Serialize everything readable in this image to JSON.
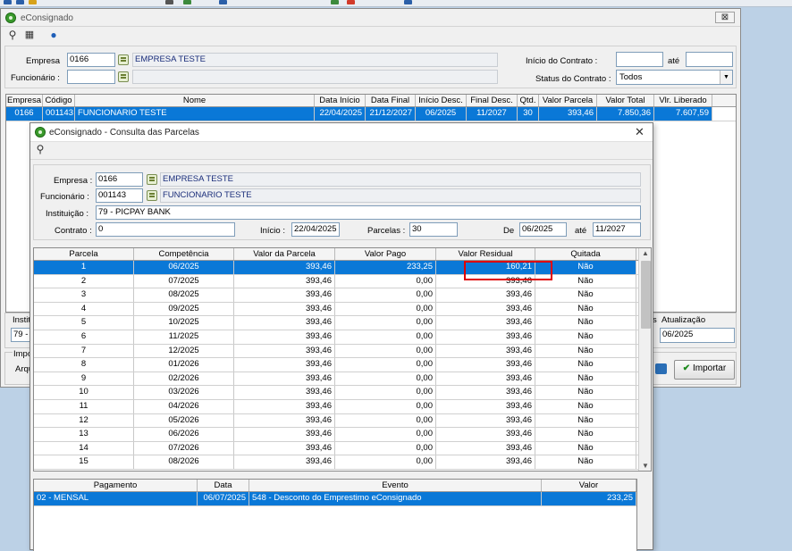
{
  "main": {
    "title": "eConsignado",
    "close_label": "⊠",
    "empresa": {
      "label": "Empresa",
      "code": "0166",
      "name": "EMPRESA TESTE"
    },
    "funcionario": {
      "label": "Funcionário :",
      "code": "",
      "name": ""
    },
    "inicio_contrato": {
      "label": "Início do Contrato :",
      "value": "",
      "ate_label": "até",
      "ate_value": ""
    },
    "status": {
      "label": "Status do Contrato :",
      "value": "Todos"
    },
    "grid": {
      "headers": [
        "Empresa",
        "Código",
        "Nome",
        "Data Início",
        "Data Final",
        "Início Desc.",
        "Final Desc.",
        "Qtd.",
        "Valor Parcela",
        "Valor Total",
        "Vlr. Liberado"
      ],
      "rows": [
        [
          "0166",
          "001143",
          "FUNCIONARIO TESTE",
          "22/04/2025",
          "21/12/2027",
          "06/2025",
          "11/2027",
          "30",
          "393,46",
          "7.850,36",
          "7.607,59"
        ]
      ]
    },
    "bottom": {
      "instituicao_label": "Instit",
      "instituicao_value": "79 - I",
      "importacao_label": "Impo",
      "arquivo_label": "Arqu",
      "atualizacao_label": "Atualização",
      "atualizacao_value": "06/2025",
      "atualizacao_prefix": "s",
      "importar_label": "Importar"
    }
  },
  "dialog": {
    "title": "eConsignado - Consulta das Parcelas",
    "close_label": "✕",
    "empresa": {
      "label": "Empresa :",
      "code": "0166",
      "name": "EMPRESA TESTE"
    },
    "funcionario": {
      "label": "Funcionário :",
      "code": "001143",
      "name": "FUNCIONARIO TESTE"
    },
    "instituicao": {
      "label": "Instituição :",
      "value": "79 - PICPAY BANK"
    },
    "contrato": {
      "label": "Contrato :",
      "value": "0"
    },
    "inicio": {
      "label": "Início :",
      "value": "22/04/2025"
    },
    "parcelas": {
      "label": "Parcelas :",
      "value": "30"
    },
    "de": {
      "label": "De",
      "value": "06/2025"
    },
    "ate": {
      "label": "até",
      "value": "11/2027"
    },
    "parcelas_grid": {
      "headers": [
        "Parcela",
        "Competência",
        "Valor da Parcela",
        "Valor Pago",
        "Valor Residual",
        "Quitada"
      ],
      "rows": [
        [
          "1",
          "06/2025",
          "393,46",
          "233,25",
          "160,21",
          "Não"
        ],
        [
          "2",
          "07/2025",
          "393,46",
          "0,00",
          "393,46",
          "Não"
        ],
        [
          "3",
          "08/2025",
          "393,46",
          "0,00",
          "393,46",
          "Não"
        ],
        [
          "4",
          "09/2025",
          "393,46",
          "0,00",
          "393,46",
          "Não"
        ],
        [
          "5",
          "10/2025",
          "393,46",
          "0,00",
          "393,46",
          "Não"
        ],
        [
          "6",
          "11/2025",
          "393,46",
          "0,00",
          "393,46",
          "Não"
        ],
        [
          "7",
          "12/2025",
          "393,46",
          "0,00",
          "393,46",
          "Não"
        ],
        [
          "8",
          "01/2026",
          "393,46",
          "0,00",
          "393,46",
          "Não"
        ],
        [
          "9",
          "02/2026",
          "393,46",
          "0,00",
          "393,46",
          "Não"
        ],
        [
          "10",
          "03/2026",
          "393,46",
          "0,00",
          "393,46",
          "Não"
        ],
        [
          "11",
          "04/2026",
          "393,46",
          "0,00",
          "393,46",
          "Não"
        ],
        [
          "12",
          "05/2026",
          "393,46",
          "0,00",
          "393,46",
          "Não"
        ],
        [
          "13",
          "06/2026",
          "393,46",
          "0,00",
          "393,46",
          "Não"
        ],
        [
          "14",
          "07/2026",
          "393,46",
          "0,00",
          "393,46",
          "Não"
        ],
        [
          "15",
          "08/2026",
          "393,46",
          "0,00",
          "393,46",
          "Não"
        ]
      ]
    },
    "pagamentos_grid": {
      "headers": [
        "Pagamento",
        "Data",
        "Evento",
        "Valor"
      ],
      "rows": [
        [
          "02 - MENSAL",
          "06/07/2025",
          "548 - Desconto do Emprestimo eConsignado",
          "233,25"
        ]
      ]
    }
  },
  "colors": {
    "selection": "#0a78d7",
    "highlight_box": "#e00000",
    "desktop": "#bcd1e6"
  }
}
